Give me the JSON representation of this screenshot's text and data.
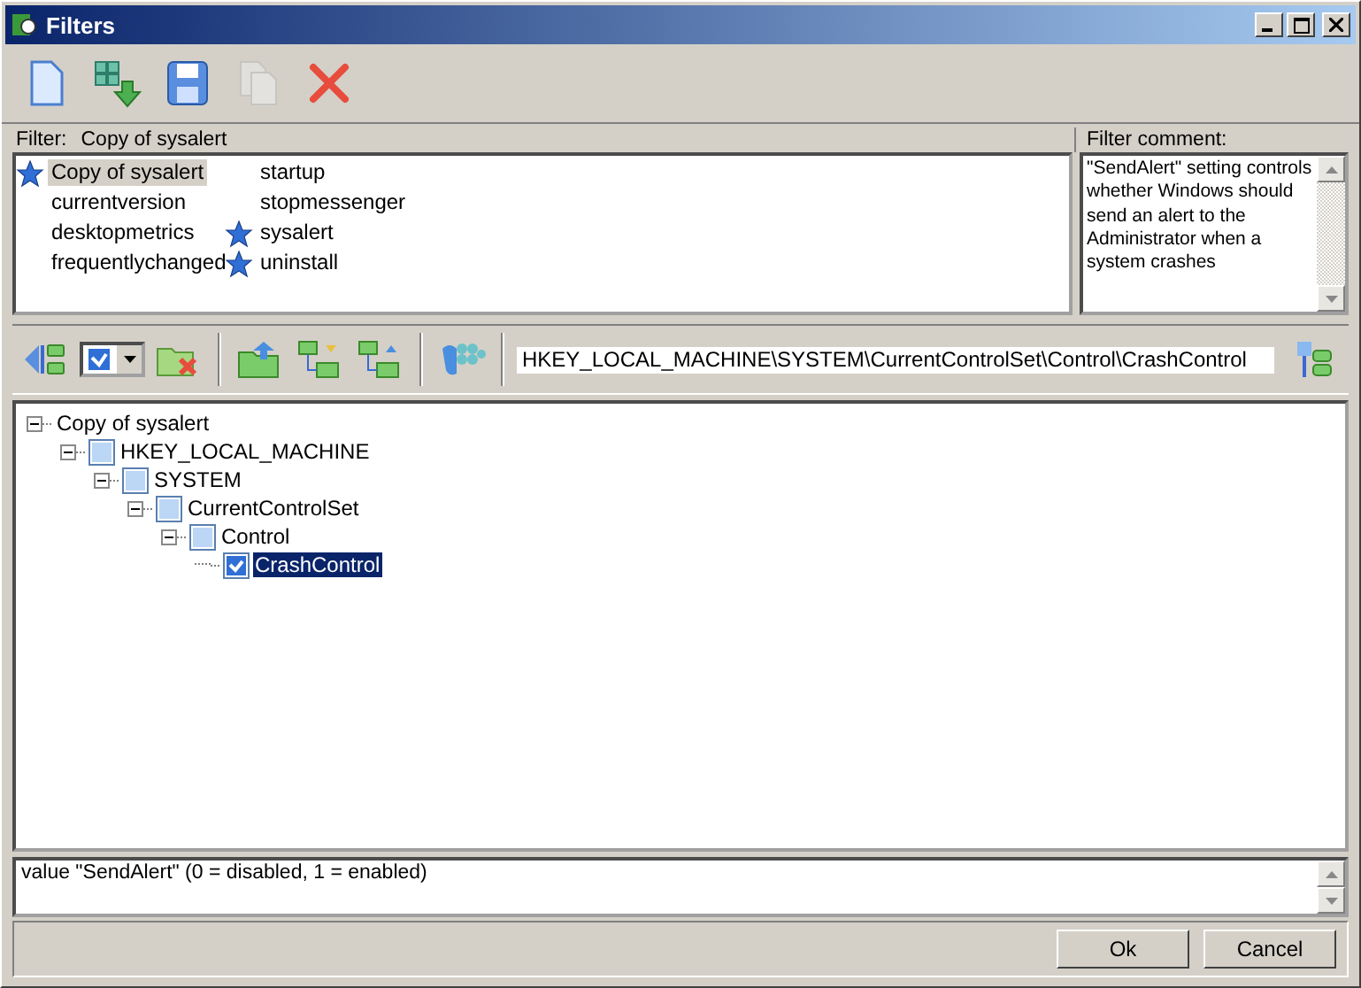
{
  "window": {
    "title": "Filters"
  },
  "toolbar": [
    {
      "kind": "new",
      "disabled": false
    },
    {
      "kind": "import",
      "disabled": false
    },
    {
      "kind": "save",
      "disabled": false
    },
    {
      "kind": "copy",
      "disabled": true
    },
    {
      "kind": "delete",
      "disabled": false
    }
  ],
  "filter": {
    "label": "Filter:",
    "name": "Copy of sysalert",
    "comment_label": "Filter comment:",
    "comment": "\"SendAlert\" setting controls whether Windows should send an alert to the Administrator when a system crashes"
  },
  "filters": [
    {
      "label": "Copy of sysalert",
      "starred": true,
      "selected": true
    },
    {
      "label": "currentversion",
      "starred": false,
      "selected": false
    },
    {
      "label": "desktopmetrics",
      "starred": false,
      "selected": false
    },
    {
      "label": "frequentlychanged",
      "starred": false,
      "selected": false
    },
    {
      "label": "startup",
      "starred": false,
      "selected": false
    },
    {
      "label": "stopmessenger",
      "starred": false,
      "selected": false
    },
    {
      "label": "sysalert",
      "starred": true,
      "selected": false
    },
    {
      "label": "uninstall",
      "starred": true,
      "selected": false
    }
  ],
  "path": {
    "value": "HKEY_LOCAL_MACHINE\\SYSTEM\\CurrentControlSet\\Control\\CrashControl"
  },
  "tree": [
    {
      "label": "Copy of sysalert",
      "kind": "root",
      "expanded": true,
      "children": [
        {
          "label": "HKEY_LOCAL_MACHINE",
          "kind": "key",
          "checked": false,
          "selected": false,
          "expanded": true,
          "children": [
            {
              "label": "SYSTEM",
              "kind": "key",
              "checked": false,
              "selected": false,
              "expanded": true,
              "children": [
                {
                  "label": "CurrentControlSet",
                  "kind": "key",
                  "checked": false,
                  "selected": false,
                  "expanded": true,
                  "children": [
                    {
                      "label": "Control",
                      "kind": "key",
                      "checked": false,
                      "selected": false,
                      "expanded": true,
                      "children": [
                        {
                          "label": "CrashControl",
                          "kind": "key",
                          "checked": true,
                          "selected": true
                        }
                      ]
                    }
                  ]
                }
              ]
            }
          ]
        }
      ]
    }
  ],
  "description": "value \"SendAlert\" (0 = disabled, 1 = enabled)",
  "buttons": [
    "Ok",
    "Cancel"
  ]
}
